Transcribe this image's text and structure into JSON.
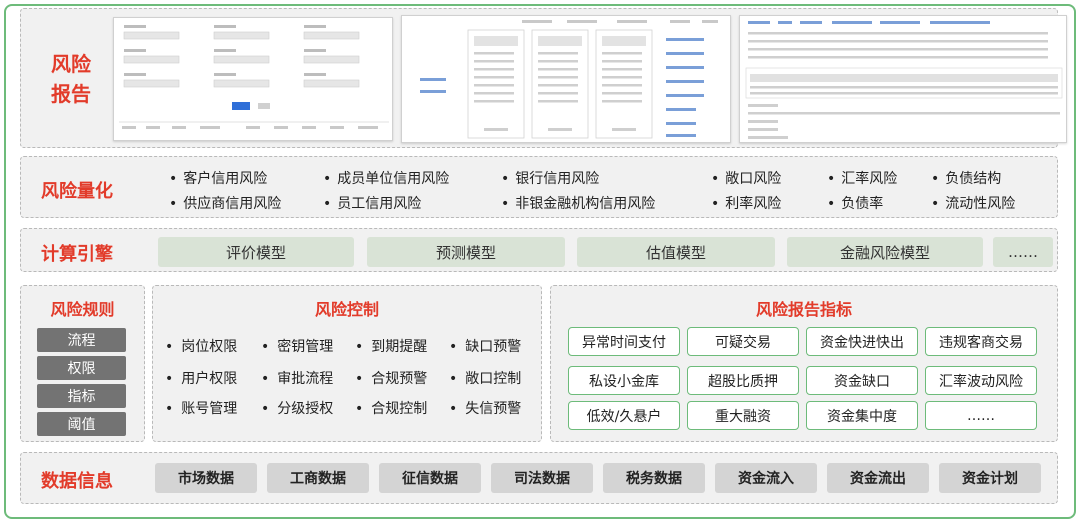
{
  "report": {
    "title": "风险报告"
  },
  "quant": {
    "title": "风险量化",
    "items": [
      "客户信用风险",
      "成员单位信用风险",
      "银行信用风险",
      "敞口风险",
      "汇率风险",
      "负债结构",
      "供应商信用风险",
      "员工信用风险",
      "非银金融机构信用风险",
      "利率风险",
      "负债率",
      "流动性风险"
    ]
  },
  "engine": {
    "title": "计算引擎",
    "models": [
      "评价模型",
      "预测模型",
      "估值模型",
      "金融风险模型",
      "……"
    ]
  },
  "rules": {
    "title": "风险规则",
    "items": [
      "流程",
      "权限",
      "指标",
      "阈值"
    ]
  },
  "control": {
    "title": "风险控制",
    "items": [
      "岗位权限",
      "密钥管理",
      "到期提醒",
      "缺口预警",
      "用户权限",
      "审批流程",
      "合规预警",
      "敞口控制",
      "账号管理",
      "分级授权",
      "合规控制",
      "失信预警"
    ]
  },
  "indicators": {
    "title": "风险报告指标",
    "items": [
      "异常时间支付",
      "可疑交易",
      "资金快进快出",
      "违规客商交易",
      "私设小金库",
      "超股比质押",
      "资金缺口",
      "汇率波动风险",
      "低效/久悬户",
      "重大融资",
      "资金集中度",
      "……"
    ]
  },
  "data": {
    "title": "数据信息",
    "items": [
      "市场数据",
      "工商数据",
      "征信数据",
      "司法数据",
      "税务数据",
      "资金流入",
      "资金流出",
      "资金计划"
    ]
  }
}
